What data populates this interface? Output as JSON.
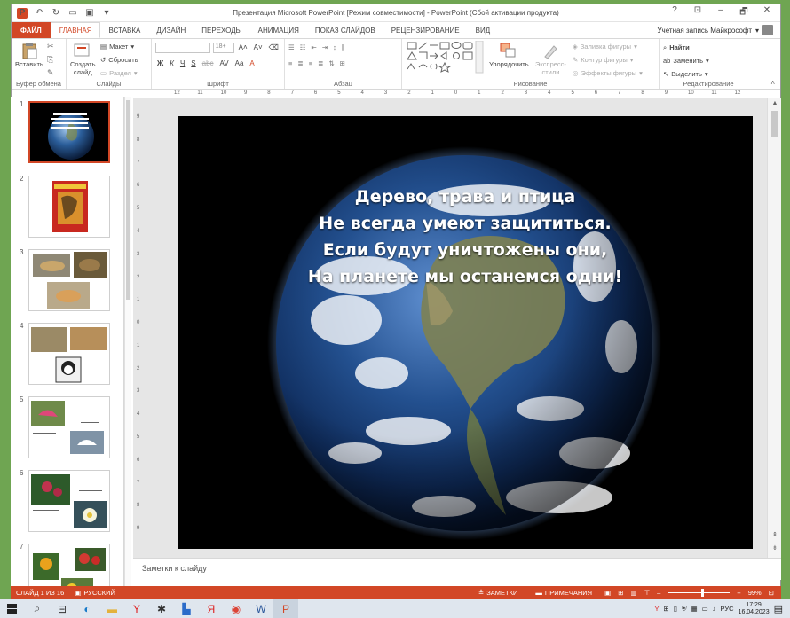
{
  "window": {
    "title": "Презентация Microsoft PowerPoint [Режим совместимости] - PowerPoint (Сбой активации продукта)",
    "controls": [
      "?",
      "⊡",
      "–",
      "🗗",
      "✕"
    ]
  },
  "tabs": [
    "ФАЙЛ",
    "ГЛАВНАЯ",
    "ВСТАВКА",
    "ДИЗАЙН",
    "ПЕРЕХОДЫ",
    "АНИМАЦИЯ",
    "ПОКАЗ СЛАЙДОВ",
    "РЕЦЕНЗИРОВАНИЕ",
    "ВИД"
  ],
  "account": "Учетная запись Майкрософт",
  "ribbon": {
    "clipboard": {
      "paste": "Вставить",
      "label": "Буфер обмена"
    },
    "slides": {
      "create": "Создать",
      "create2": "слайд",
      "layout": "Макет",
      "reset": "Сбросить",
      "section": "Раздел",
      "label": "Слайды"
    },
    "font": {
      "size": "18+",
      "label": "Шрифт",
      "bold": "Ж",
      "italic": "К",
      "underline": "Ч",
      "strike": "S",
      "abc": "abc",
      "av": "AV",
      "aa": "Aa"
    },
    "paragraph": {
      "label": "Абзац"
    },
    "drawing": {
      "arrange": "Упорядочить",
      "express": "Экспресс-",
      "express2": "стили",
      "fill": "Заливка фигуры",
      "outline": "Контур фигуры",
      "effects": "Эффекты фигуры",
      "label": "Рисование"
    },
    "editing": {
      "find": "Найти",
      "replace": "Заменить",
      "select": "Выделить",
      "label": "Редактирование"
    }
  },
  "ruler_h": [
    "12",
    "11",
    "10",
    "9",
    "8",
    "7",
    "6",
    "5",
    "4",
    "3",
    "2",
    "1",
    "0",
    "1",
    "2",
    "3",
    "4",
    "5",
    "6",
    "7",
    "8",
    "9",
    "10",
    "11",
    "12"
  ],
  "ruler_v": [
    "9",
    "8",
    "7",
    "6",
    "5",
    "4",
    "3",
    "2",
    "1",
    "0",
    "1",
    "2",
    "3",
    "4",
    "5",
    "6",
    "7",
    "8",
    "9"
  ],
  "thumbnails": [
    "1",
    "2",
    "3",
    "4",
    "5",
    "6",
    "7"
  ],
  "slide": {
    "lines": [
      "Дерево, трава и птица",
      "Не всегда умеют защититься.",
      "Если будут уничтожены они,",
      "На планете мы останемся одни!"
    ]
  },
  "notes_placeholder": "Заметки к слайду",
  "status": {
    "slide_counter": "СЛАЙД 1 ИЗ 16",
    "language": "РУССКИЙ",
    "notes": "ЗАМЕТКИ",
    "comments": "ПРИМЕЧАНИЯ",
    "zoom": "99%"
  },
  "taskbar": {
    "lang": "РУС",
    "time": "17:29",
    "date": "16.04.2023"
  },
  "colors": {
    "accent": "#d24726",
    "desktop": "#6fa552"
  }
}
